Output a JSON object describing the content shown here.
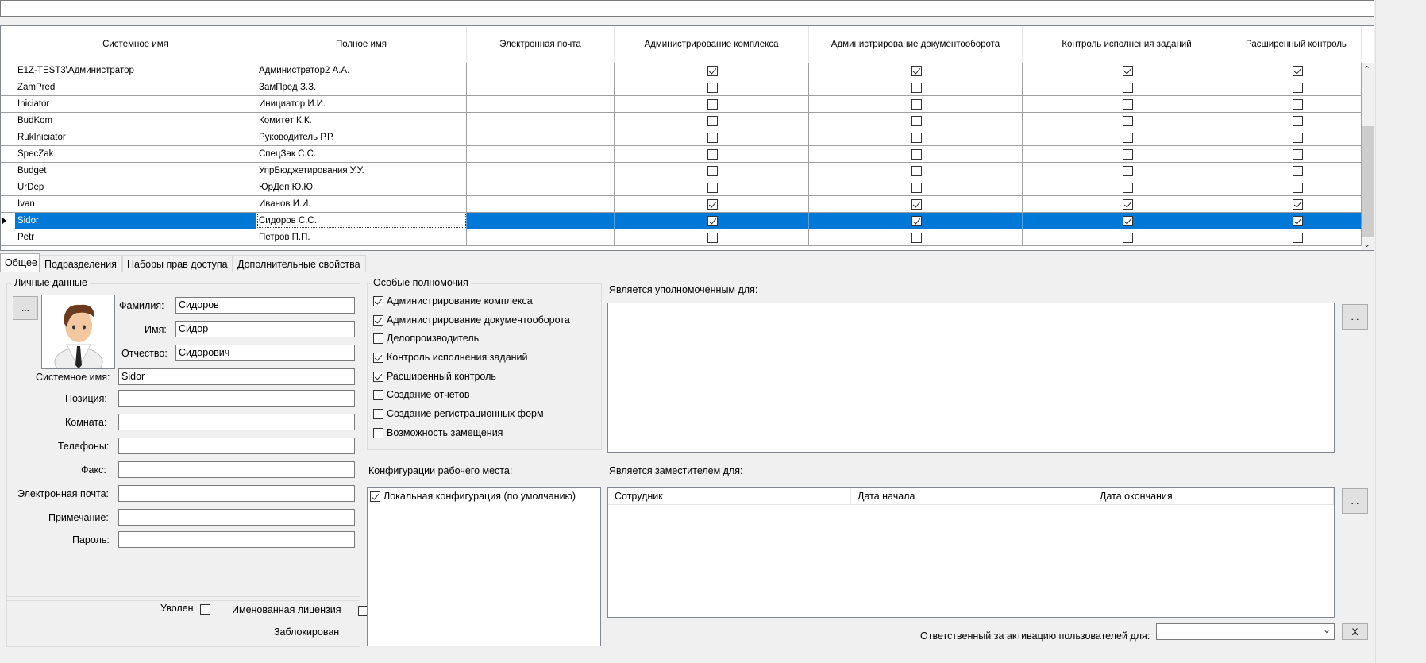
{
  "grid": {
    "columns": [
      "Системное имя",
      "Полное имя",
      "Электронная почта",
      "Администрирование комплекса",
      "Администрирование документооборота",
      "Контроль исполнения заданий",
      "Расширенный контроль"
    ],
    "rows": [
      {
        "sys": "E1Z-TEST3\\Администратор",
        "full": "Администратор2 А.А.",
        "email": "",
        "c1": true,
        "c2": true,
        "c3": true,
        "c4": true
      },
      {
        "sys": "ZamPred",
        "full": "ЗамПред З.З.",
        "email": "",
        "c1": false,
        "c2": false,
        "c3": false,
        "c4": false
      },
      {
        "sys": "Iniciator",
        "full": "Инициатор И.И.",
        "email": "",
        "c1": false,
        "c2": false,
        "c3": false,
        "c4": false
      },
      {
        "sys": "BudKom",
        "full": "Комитет К.К.",
        "email": "",
        "c1": false,
        "c2": false,
        "c3": false,
        "c4": false
      },
      {
        "sys": "RukIniciator",
        "full": "Руководитель Р.Р.",
        "email": "",
        "c1": false,
        "c2": false,
        "c3": false,
        "c4": false
      },
      {
        "sys": "SpecZak",
        "full": "СпецЗак С.С.",
        "email": "",
        "c1": false,
        "c2": false,
        "c3": false,
        "c4": false
      },
      {
        "sys": "Budget",
        "full": "УпрБюджетирования У.У.",
        "email": "",
        "c1": false,
        "c2": false,
        "c3": false,
        "c4": false
      },
      {
        "sys": "UrDep",
        "full": "ЮрДеп Ю.Ю.",
        "email": "",
        "c1": false,
        "c2": false,
        "c3": false,
        "c4": false
      },
      {
        "sys": "Ivan",
        "full": "Иванов И.И.",
        "email": "",
        "c1": true,
        "c2": true,
        "c3": true,
        "c4": true
      },
      {
        "sys": "Sidor",
        "full": "Сидоров С.С.",
        "email": "",
        "c1": true,
        "c2": true,
        "c3": true,
        "c4": true,
        "selected": true
      },
      {
        "sys": "Petr",
        "full": "Петров П.П.",
        "email": "",
        "c1": false,
        "c2": false,
        "c3": false,
        "c4": false
      }
    ]
  },
  "tabs": [
    "Общее",
    "Подразделения",
    "Наборы прав доступа",
    "Дополнительные свойства"
  ],
  "personal": {
    "title": "Личные данные",
    "photo_button": "...",
    "surname_label": "Фамилия:",
    "surname": "Сидоров",
    "name_label": "Имя:",
    "name": "Сидор",
    "patronymic_label": "Отчество:",
    "patronymic": "Сидорович",
    "sysname_label": "Системное имя:",
    "sysname": "Sidor",
    "position_label": "Позиция:",
    "position": "",
    "room_label": "Комната:",
    "room": "",
    "phones_label": "Телефоны:",
    "phones": "",
    "fax_label": "Факс:",
    "fax": "",
    "email_label": "Электронная почта:",
    "email": "",
    "note_label": "Примечание:",
    "note": "",
    "password_label": "Пароль:",
    "password": ""
  },
  "flags": {
    "fired_label": "Уволен",
    "fired": false,
    "license_label": "Именованная лицензия",
    "license": false,
    "blocked_label": "Заблокирован",
    "blocked": false
  },
  "special": {
    "title": "Особые полномочия",
    "items": [
      {
        "label": "Администрирование комплекса",
        "checked": true
      },
      {
        "label": "Администрирование документооборота",
        "checked": true
      },
      {
        "label": "Делопроизводитель",
        "checked": false
      },
      {
        "label": "Контроль исполнения заданий",
        "checked": true
      },
      {
        "label": "Расширенный контроль",
        "checked": true
      },
      {
        "label": "Создание отчетов",
        "checked": false
      },
      {
        "label": "Создание регистрационных форм",
        "checked": false
      },
      {
        "label": "Возможность замещения",
        "checked": false
      }
    ]
  },
  "workplace": {
    "title": "Конфигурации рабочего места:",
    "items": [
      {
        "label": "Локальная конфигурация (по умолчанию)",
        "checked": true
      }
    ]
  },
  "authorized": {
    "title": "Является уполномоченным для:",
    "button": "..."
  },
  "deputy": {
    "title": "Является заместителем для:",
    "button": "...",
    "columns": [
      "Сотрудник",
      "Дата начала",
      "Дата окончания"
    ]
  },
  "activation": {
    "label": "Ответственный за активацию пользователей для:",
    "value": "",
    "clear_button": "X"
  }
}
